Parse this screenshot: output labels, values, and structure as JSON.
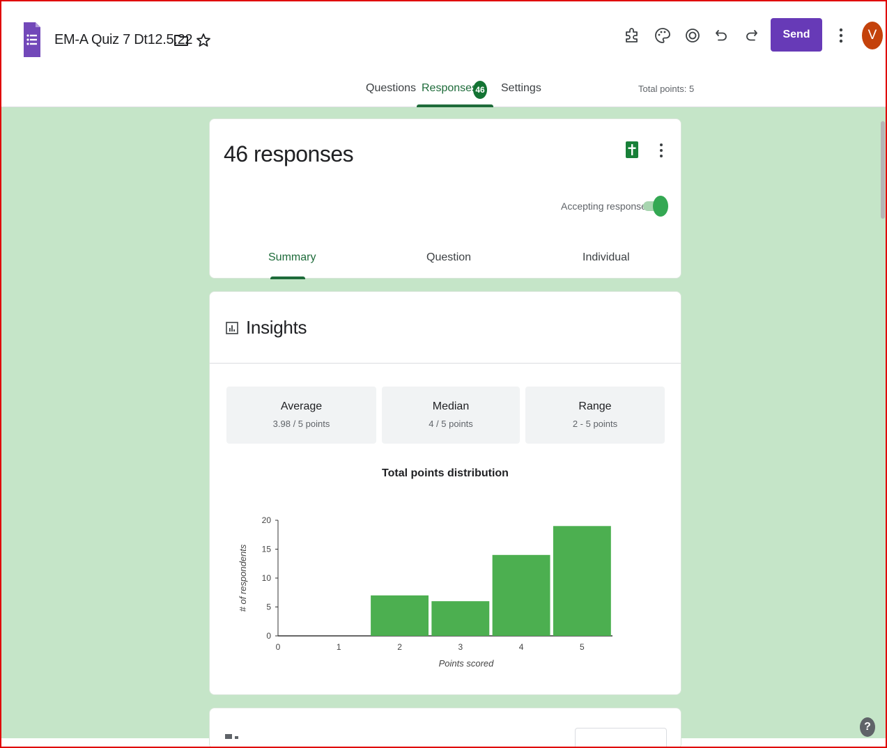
{
  "header": {
    "title": "EM-A Quiz 7 Dt12.5.22",
    "send_label": "Send",
    "avatar_initial": "V",
    "tabs": [
      {
        "label": "Questions"
      },
      {
        "label": "Responses",
        "count": "46"
      },
      {
        "label": "Settings"
      }
    ],
    "total_points": "Total points: 5",
    "icons": [
      "folder-icon",
      "star-icon",
      "addon-icon",
      "palette-icon",
      "preview-icon",
      "undo-icon",
      "redo-icon",
      "more-vert-icon"
    ]
  },
  "responses_card": {
    "title": "46 responses",
    "accepting_label": "Accepting responses",
    "accepting": true,
    "subtabs": [
      {
        "label": "Summary"
      },
      {
        "label": "Question"
      },
      {
        "label": "Individual"
      }
    ]
  },
  "insights": {
    "title": "Insights",
    "stats": [
      {
        "label": "Average",
        "value": "3.98 / 5 points"
      },
      {
        "label": "Median",
        "value": "4 / 5 points"
      },
      {
        "label": "Range",
        "value": "2 - 5 points"
      }
    ]
  },
  "colors": {
    "accent": "#673ab7",
    "background": "#c5e5c8",
    "bar": "#4caf50",
    "active_tab": "#1e6b3a"
  },
  "chart_data": {
    "type": "bar",
    "title": "Total points distribution",
    "xlabel": "Points scored",
    "ylabel": "# of respondents",
    "categories": [
      "1",
      "2",
      "3",
      "4",
      "5"
    ],
    "values": [
      0,
      7,
      6,
      14,
      19
    ],
    "x_ticks": [
      "0",
      "1",
      "2",
      "3",
      "4",
      "5"
    ],
    "y_ticks": [
      0,
      5,
      10,
      15,
      20
    ],
    "ylim": [
      0,
      20
    ],
    "grid": false,
    "legend": "none"
  }
}
